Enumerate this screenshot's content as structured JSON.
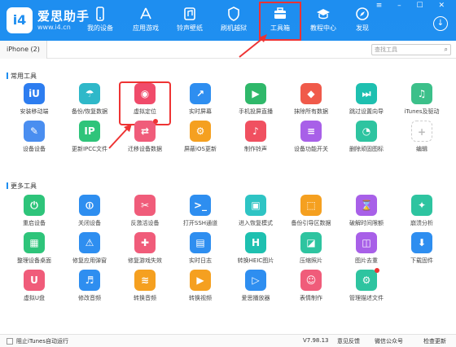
{
  "app": {
    "brand": "爱思助手",
    "url": "www.i4.cn",
    "logo": "i4",
    "window_controls": "≡ – ☐ ✕"
  },
  "nav": [
    {
      "label": "我的设备",
      "icon": "phone-icon"
    },
    {
      "label": "应用游戏",
      "icon": "appstore-icon"
    },
    {
      "label": "铃声壁纸",
      "icon": "ringtone-icon"
    },
    {
      "label": "刷机越狱",
      "icon": "shield-icon"
    },
    {
      "label": "工具箱",
      "icon": "toolbox-icon"
    },
    {
      "label": "教程中心",
      "icon": "graduation-icon"
    },
    {
      "label": "发现",
      "icon": "discover-icon"
    }
  ],
  "device_tab": "iPhone (2)",
  "search": {
    "placeholder": "查找工具"
  },
  "sections": {
    "common": "常用工具",
    "more": "更多工具"
  },
  "common_tools": [
    {
      "label": "安装移动端",
      "color": "#2d7df0",
      "glyph": "iU"
    },
    {
      "label": "备份/恢复数据",
      "color": "#2fb8c9",
      "glyph": "☂"
    },
    {
      "label": "虚拟定位",
      "color": "#f04b6a",
      "glyph": "◉"
    },
    {
      "label": "实时屏幕",
      "color": "#2e8ef0",
      "glyph": "↗"
    },
    {
      "label": "手机投屏直播",
      "color": "#2fb86a",
      "glyph": "▶"
    },
    {
      "label": "抹除所有数据",
      "color": "#f05a4a",
      "glyph": "◆"
    },
    {
      "label": "跳过设置向导",
      "color": "#1ec0b0",
      "glyph": "⏭"
    },
    {
      "label": "iTunes及驱动",
      "color": "#3cc08a",
      "glyph": "♫"
    },
    {
      "label": "设备设备",
      "color": "#4a8ef0",
      "glyph": "✎"
    },
    {
      "label": "更新IPCC文件",
      "color": "#2ec47a",
      "glyph": "IP"
    },
    {
      "label": "迁移设备数据",
      "color": "#f05c7a",
      "glyph": "⇄"
    },
    {
      "label": "屏蔽iOS更新",
      "color": "#f5a020",
      "glyph": "⚙"
    },
    {
      "label": "制作铃声",
      "color": "#f05060",
      "glyph": "♪"
    },
    {
      "label": "设备功能开关",
      "color": "#a860e8",
      "glyph": "≡"
    },
    {
      "label": "删除顽固图标",
      "color": "#2ec4a0",
      "glyph": "◔"
    },
    {
      "label": "编辑",
      "color": "#ffffff",
      "glyph": "+"
    }
  ],
  "more_tools": [
    {
      "label": "重启设备",
      "color": "#2ec47a",
      "glyph": "⏻"
    },
    {
      "label": "关闭设备",
      "color": "#2e8ef0",
      "glyph": "⏼"
    },
    {
      "label": "反激活设备",
      "color": "#f05c7a",
      "glyph": "✂"
    },
    {
      "label": "打开SSH通道",
      "color": "#2e8ef0",
      "glyph": ">_"
    },
    {
      "label": "进入恢复模式",
      "color": "#2ec4c4",
      "glyph": "▣"
    },
    {
      "label": "备份引导区数据",
      "color": "#f5a020",
      "glyph": "⬚"
    },
    {
      "label": "破解时间限额",
      "color": "#a860e8",
      "glyph": "⌛"
    },
    {
      "label": "崩溃分析",
      "color": "#2ec4a0",
      "glyph": "✦"
    },
    {
      "label": "整理设备桌面",
      "color": "#2ec47a",
      "glyph": "▦"
    },
    {
      "label": "修复应用弹窗",
      "color": "#2e8ef0",
      "glyph": "⚠"
    },
    {
      "label": "修复游戏失效",
      "color": "#f05c7a",
      "glyph": "✚"
    },
    {
      "label": "实时日志",
      "color": "#2e8ef0",
      "glyph": "▤"
    },
    {
      "label": "转换HEIC图片",
      "color": "#1ec0b0",
      "glyph": "H"
    },
    {
      "label": "压缩照片",
      "color": "#2ec4a0",
      "glyph": "◪"
    },
    {
      "label": "图片去重",
      "color": "#a860e8",
      "glyph": "◫"
    },
    {
      "label": "下载固件",
      "color": "#2e8ef0",
      "glyph": "⬇"
    },
    {
      "label": "虚拟U盘",
      "color": "#f05c7a",
      "glyph": "U"
    },
    {
      "label": "修改音频",
      "color": "#2e8ef0",
      "glyph": "♬"
    },
    {
      "label": "转换音频",
      "color": "#f5a020",
      "glyph": "≋"
    },
    {
      "label": "转换视频",
      "color": "#f5a020",
      "glyph": "▶"
    },
    {
      "label": "爱思播放器",
      "color": "#2e8ef0",
      "glyph": "▷"
    },
    {
      "label": "表情制作",
      "color": "#f05c7a",
      "glyph": "☺"
    },
    {
      "label": "管理描述文件",
      "color": "#2ec4a0",
      "glyph": "⚙"
    }
  ],
  "footer": {
    "checkbox_label": "阻止iTunes自动运行",
    "version": "V7.98.13",
    "feedback": "意见反馈",
    "wechat": "微信公众号",
    "update": "检查更新"
  }
}
